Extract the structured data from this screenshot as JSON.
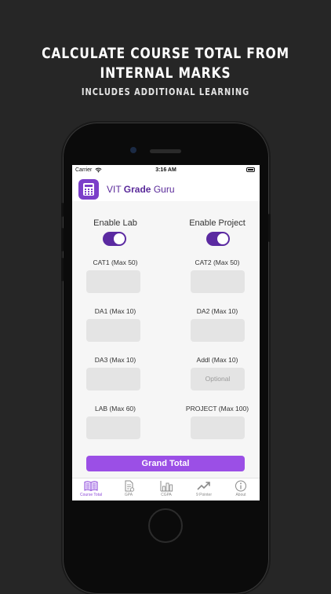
{
  "promo": {
    "headline_line1": "CALCULATE COURSE TOTAL FROM",
    "headline_line2": "INTERNAL MARKS",
    "subheadline": "INCLUDES ADDITIONAL LEARNING"
  },
  "status_bar": {
    "carrier": "Carrier",
    "time": "3:16 AM"
  },
  "app": {
    "title_pre": "VIT ",
    "title_bold": "Grade",
    "title_post": " Guru",
    "accent": "#5b2aa1"
  },
  "toggles": [
    {
      "label": "Enable Lab",
      "on": true
    },
    {
      "label": "Enable Project",
      "on": true
    }
  ],
  "fields": [
    {
      "label": "CAT1 (Max 50)",
      "value": "",
      "placeholder": ""
    },
    {
      "label": "CAT2 (Max 50)",
      "value": "",
      "placeholder": ""
    },
    {
      "label": "DA1 (Max 10)",
      "value": "",
      "placeholder": ""
    },
    {
      "label": "DA2 (Max 10)",
      "value": "",
      "placeholder": ""
    },
    {
      "label": "DA3 (Max 10)",
      "value": "",
      "placeholder": ""
    },
    {
      "label": "Addl (Max 10)",
      "value": "",
      "placeholder": "Optional"
    },
    {
      "label": "LAB (Max 60)",
      "value": "",
      "placeholder": ""
    },
    {
      "label": "PROJECT (Max 100)",
      "value": "",
      "placeholder": ""
    }
  ],
  "grand_total_label": "Grand Total",
  "tabs": [
    {
      "label": "Course Total",
      "icon": "book-icon",
      "active": true
    },
    {
      "label": "GPA",
      "icon": "document-icon",
      "active": false
    },
    {
      "label": "CGPA",
      "icon": "bar-chart-icon",
      "active": false
    },
    {
      "label": "9 Pointer",
      "icon": "trend-up-icon",
      "active": false
    },
    {
      "label": "About",
      "icon": "info-icon",
      "active": false
    }
  ]
}
